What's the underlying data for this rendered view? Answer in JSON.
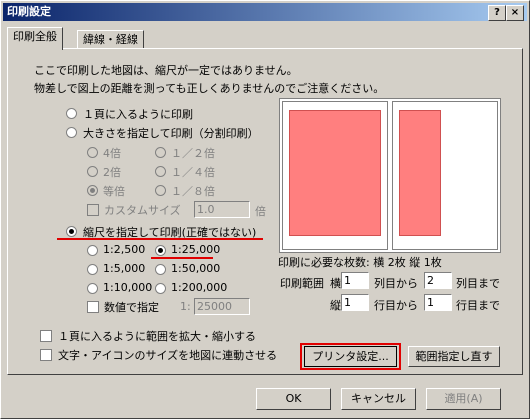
{
  "window": {
    "title": "印刷設定"
  },
  "tabs": [
    {
      "label": "印刷全般"
    },
    {
      "label": "緯線・経線"
    }
  ],
  "notice": {
    "line1": "ここで印刷した地図は、縮尺が一定ではありません。",
    "line2": "物差しで図上の距離を測っても正しくありませんのでご注意ください。"
  },
  "mode": {
    "fit_one_page": "１頁に入るように印刷",
    "split_print": "大きさを指定して印刷（分割印刷）",
    "scale_print": "縮尺を指定して印刷(正確ではない)"
  },
  "split": {
    "x4": "4倍",
    "x2": "2倍",
    "x1": "等倍",
    "half": "１／２倍",
    "quarter": "１／４倍",
    "eighth": "１／８倍",
    "custom_label": "カスタムサイズ",
    "custom_value": "1.0",
    "custom_unit": "倍"
  },
  "scale": {
    "s2500": "1:2,500",
    "s25000": "1:25,000",
    "s5000": "1:5,000",
    "s50000": "1:50,000",
    "s10000": "1:10,000",
    "s200000": "1:200,000",
    "numeric_label": "数値で指定",
    "numeric_prefix": "1:",
    "numeric_value": "25000",
    "selected": "1:25,000"
  },
  "pages": {
    "required_text": "印刷に必要な枚数: 横 2枚 縦 1枚",
    "range_label": "印刷範囲",
    "horizontal_label": "横",
    "horizontal_from": "1",
    "col_from_label": "列目から",
    "horizontal_to": "2",
    "col_to_label": "列目まで",
    "vertical_label": "縦",
    "vertical_from": "1",
    "row_from_label": "行目から",
    "vertical_to": "1",
    "row_to_label": "行目まで"
  },
  "options": {
    "expand_to_page": "１頁に入るように範囲を拡大・縮小する",
    "link_text_icon_size": "文字・アイコンのサイズを地図に連動させる"
  },
  "buttons": {
    "printer_settings": "プリンタ設定...",
    "reset_range": "範囲指定し直す",
    "ok": "OK",
    "cancel": "キャンセル",
    "apply": "適用(A)"
  },
  "colors": {
    "highlight": "#e00000",
    "page_fill": "#ff7f7f"
  }
}
